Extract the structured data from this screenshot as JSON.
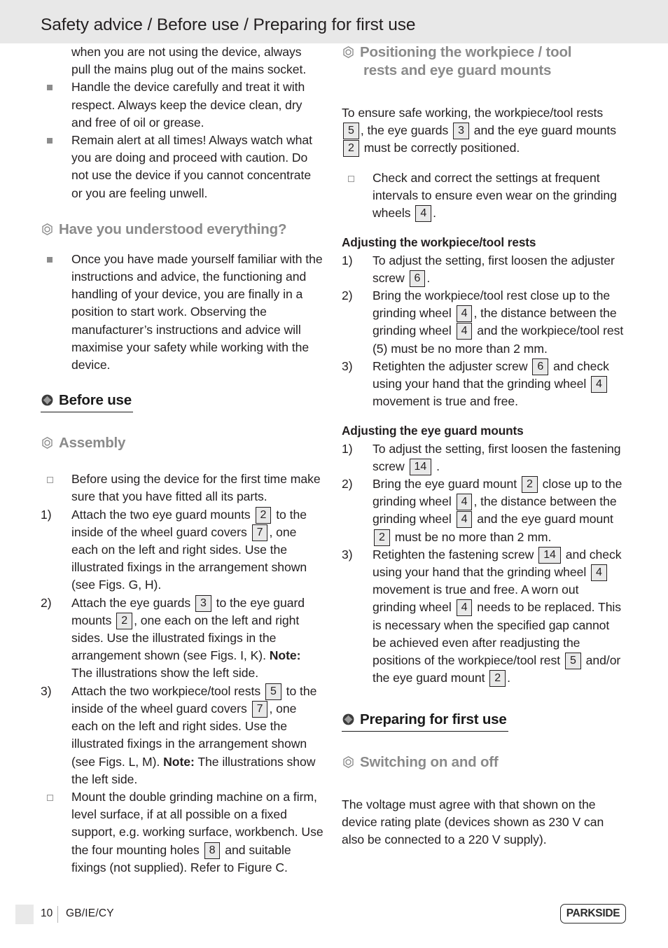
{
  "header": {
    "title": "Safety advice / Before use / Preparing for first use"
  },
  "left_column": {
    "safety_items": [
      {
        "marker": "",
        "bullet": "none",
        "text": "when you are not using the device, always pull the mains plug out of the mains socket."
      },
      {
        "marker": "",
        "bullet": "square-filled",
        "text": "Handle the device carefully and treat it with respect. Always keep the device clean, dry and free of oil or grease."
      },
      {
        "marker": "",
        "bullet": "square-filled",
        "text": "Remain alert at all times! Always watch what you are doing and proceed with caution. Do not use the device if you cannot concentrate or you are feeling unwell."
      }
    ],
    "understood_heading": "Have you understood everything?",
    "understood_item": "Once you have made yourself familiar with the instructions and advice, the functioning and handling of your device, you are finally in a position to start work. Observing the manufacturer’s instructions and advice will maximise your safety while working with the device.",
    "before_use_heading": "Before use",
    "assembly_heading": "Assembly",
    "assembly_items": [
      {
        "marker": "",
        "bullet": "square-hollow",
        "parts": [
          {
            "t": "text",
            "v": "Before using the device for the first time make sure that you have fitted all its parts."
          }
        ]
      },
      {
        "marker": "1)",
        "bullet": "none",
        "parts": [
          {
            "t": "text",
            "v": "Attach the two eye guard mounts "
          },
          {
            "t": "ref",
            "v": "2"
          },
          {
            "t": "text",
            "v": " to the inside of the wheel guard covers "
          },
          {
            "t": "ref",
            "v": "7"
          },
          {
            "t": "text",
            "v": ", one each on the left and right sides. Use the illustrated fixings in the arrangement shown (see Figs. G, H)."
          }
        ]
      },
      {
        "marker": "2)",
        "bullet": "none",
        "parts": [
          {
            "t": "text",
            "v": "Attach the eye guards "
          },
          {
            "t": "ref",
            "v": "3"
          },
          {
            "t": "text",
            "v": " to the eye guard mounts "
          },
          {
            "t": "ref",
            "v": "2"
          },
          {
            "t": "text",
            "v": ", one each on the left and right sides. Use the illustrated fixings in the arrangement shown (see Figs. I, K). "
          },
          {
            "t": "bold",
            "v": "Note:"
          },
          {
            "t": "text",
            "v": " The illustrations show the left side."
          }
        ]
      },
      {
        "marker": "3)",
        "bullet": "none",
        "parts": [
          {
            "t": "text",
            "v": "Attach the two workpiece/tool rests "
          },
          {
            "t": "ref",
            "v": "5"
          },
          {
            "t": "text",
            "v": " to the inside of the wheel guard covers "
          },
          {
            "t": "ref",
            "v": "7"
          },
          {
            "t": "text",
            "v": ", one each on the left and right sides. Use the illustrated fixings in the arrangement shown (see Figs. L, M). "
          },
          {
            "t": "bold",
            "v": "Note:"
          },
          {
            "t": "text",
            "v": " The illustrations show the left side."
          }
        ]
      },
      {
        "marker": "",
        "bullet": "square-hollow",
        "parts": [
          {
            "t": "text",
            "v": "Mount the double grinding machine on a firm, level surface, if at all possible on a fixed support, e.g. working surface, workbench. Use the four mounting holes "
          },
          {
            "t": "ref",
            "v": "8"
          },
          {
            "t": "text",
            "v": " and suitable fixings (not supplied). Refer to Figure C."
          }
        ]
      }
    ]
  },
  "right_column": {
    "positioning_heading_line1": "Positioning the workpiece / tool",
    "positioning_heading_line2": "rests and eye guard mounts",
    "positioning_intro": [
      {
        "t": "text",
        "v": "To ensure safe working, the workpiece/tool rests "
      },
      {
        "t": "ref",
        "v": "5"
      },
      {
        "t": "text",
        "v": ", the eye guards "
      },
      {
        "t": "ref",
        "v": "3"
      },
      {
        "t": "text",
        "v": " and the eye guard mounts "
      },
      {
        "t": "ref",
        "v": "2"
      },
      {
        "t": "text",
        "v": " must be correctly positioned."
      }
    ],
    "positioning_item": [
      {
        "t": "text",
        "v": "Check and correct the settings at frequent intervals to ensure even wear on the grinding wheels "
      },
      {
        "t": "ref",
        "v": "4"
      },
      {
        "t": "text",
        "v": "."
      }
    ],
    "tool_rests_heading": "Adjusting the workpiece/tool rests",
    "tool_rests_items": [
      {
        "marker": "1)",
        "parts": [
          {
            "t": "text",
            "v": "To adjust the setting, first loosen the adjuster screw "
          },
          {
            "t": "ref",
            "v": "6"
          },
          {
            "t": "text",
            "v": "."
          }
        ]
      },
      {
        "marker": "2)",
        "parts": [
          {
            "t": "text",
            "v": "Bring the workpiece/tool rest close up to the grinding wheel "
          },
          {
            "t": "ref",
            "v": "4"
          },
          {
            "t": "text",
            "v": ", the distance between the grinding wheel "
          },
          {
            "t": "ref",
            "v": "4"
          },
          {
            "t": "text",
            "v": " and the workpiece/tool rest (5) must be no more than 2 mm."
          }
        ]
      },
      {
        "marker": "3)",
        "parts": [
          {
            "t": "text",
            "v": "Retighten the adjuster screw "
          },
          {
            "t": "ref",
            "v": "6"
          },
          {
            "t": "text",
            "v": " and check using your hand that the grinding wheel "
          },
          {
            "t": "ref",
            "v": "4"
          },
          {
            "t": "text",
            "v": " movement is true and free."
          }
        ]
      }
    ],
    "eye_guard_heading": "Adjusting the eye guard mounts",
    "eye_guard_items": [
      {
        "marker": "1)",
        "parts": [
          {
            "t": "text",
            "v": "To adjust the setting, first loosen the fastening screw "
          },
          {
            "t": "ref",
            "v": "14"
          },
          {
            "t": "text",
            "v": " ."
          }
        ]
      },
      {
        "marker": "2)",
        "parts": [
          {
            "t": "text",
            "v": "Bring the eye guard mount "
          },
          {
            "t": "ref",
            "v": "2"
          },
          {
            "t": "text",
            "v": " close up to the grinding wheel "
          },
          {
            "t": "ref",
            "v": "4"
          },
          {
            "t": "text",
            "v": ", the distance between the grinding wheel "
          },
          {
            "t": "ref",
            "v": "4"
          },
          {
            "t": "text",
            "v": " and the eye guard mount "
          },
          {
            "t": "ref",
            "v": "2"
          },
          {
            "t": "text",
            "v": " must be no more than 2 mm."
          }
        ]
      },
      {
        "marker": "3)",
        "parts": [
          {
            "t": "text",
            "v": "Retighten the fastening screw "
          },
          {
            "t": "ref",
            "v": "14"
          },
          {
            "t": "text",
            "v": " and check using your hand that the grinding wheel "
          },
          {
            "t": "ref",
            "v": "4"
          },
          {
            "t": "text",
            "v": " movement is true and free. A worn out grinding wheel "
          },
          {
            "t": "ref",
            "v": "4"
          },
          {
            "t": "text",
            "v": " needs to be replaced. This is necessary when the specified gap cannot be achieved even after readjusting the positions of the workpiece/tool rest "
          },
          {
            "t": "ref",
            "v": "5"
          },
          {
            "t": "text",
            "v": " and/or the eye guard mount "
          },
          {
            "t": "ref",
            "v": "2"
          },
          {
            "t": "text",
            "v": "."
          }
        ]
      }
    ],
    "preparing_heading": "Preparing for first use",
    "switching_heading": "Switching on and off",
    "switching_text": "The voltage must agree with that shown on the device rating plate (devices shown as 230 V can also be connected to a 220 V supply)."
  },
  "footer": {
    "page_number": "10",
    "locale": "GB/IE/CY",
    "brand": "PARKSIDE"
  },
  "icons": {
    "main_heading": "screw-head-icon",
    "sub_heading": "hex-nut-icon",
    "bullet_filled": "filled-square-bullet-icon",
    "bullet_hollow": "hollow-square-bullet-icon"
  },
  "colors": {
    "header_band": "#e8e8e8",
    "text": "#231f20",
    "sub_heading": "#8a8a8a",
    "ref_box_fill": "#e9e9e9",
    "ref_box_border": "#231f20"
  }
}
